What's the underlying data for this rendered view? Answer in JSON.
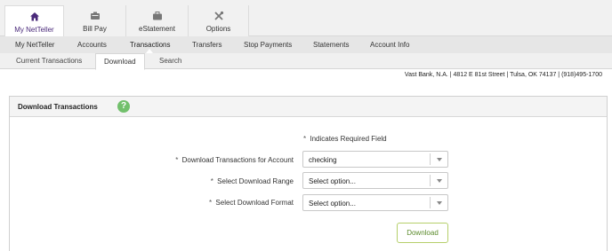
{
  "top_tabs": [
    {
      "label": "My NetTeller",
      "icon": "home-icon"
    },
    {
      "label": "Bill Pay",
      "icon": "bill-pay-icon"
    },
    {
      "label": "eStatement",
      "icon": "briefcase-icon"
    },
    {
      "label": "Options",
      "icon": "tools-icon"
    }
  ],
  "nav2": [
    "My NetTeller",
    "Accounts",
    "Transactions",
    "Transfers",
    "Stop Payments",
    "Statements",
    "Account Info"
  ],
  "nav3": [
    "Current Transactions",
    "Download",
    "Search"
  ],
  "bank_info": "Vast Bank, N.A. | 4812 E 81st Street | Tulsa, OK 74137 | (918)495-1700",
  "panel": {
    "title": "Download Transactions",
    "help": "?"
  },
  "form": {
    "required_star": "*",
    "required_note": "Indicates Required Field",
    "account_label": "Download Transactions for Account",
    "account_value": "checking",
    "range_label": "Select Download Range",
    "range_value": "Select option...",
    "format_label": "Select Download Format",
    "format_value": "Select option...",
    "button": "Download"
  },
  "colors": {
    "accent": "#4a2a7a",
    "help_green": "#72c06c",
    "button_border": "#b5cf6a",
    "button_text": "#5a8a2a"
  }
}
